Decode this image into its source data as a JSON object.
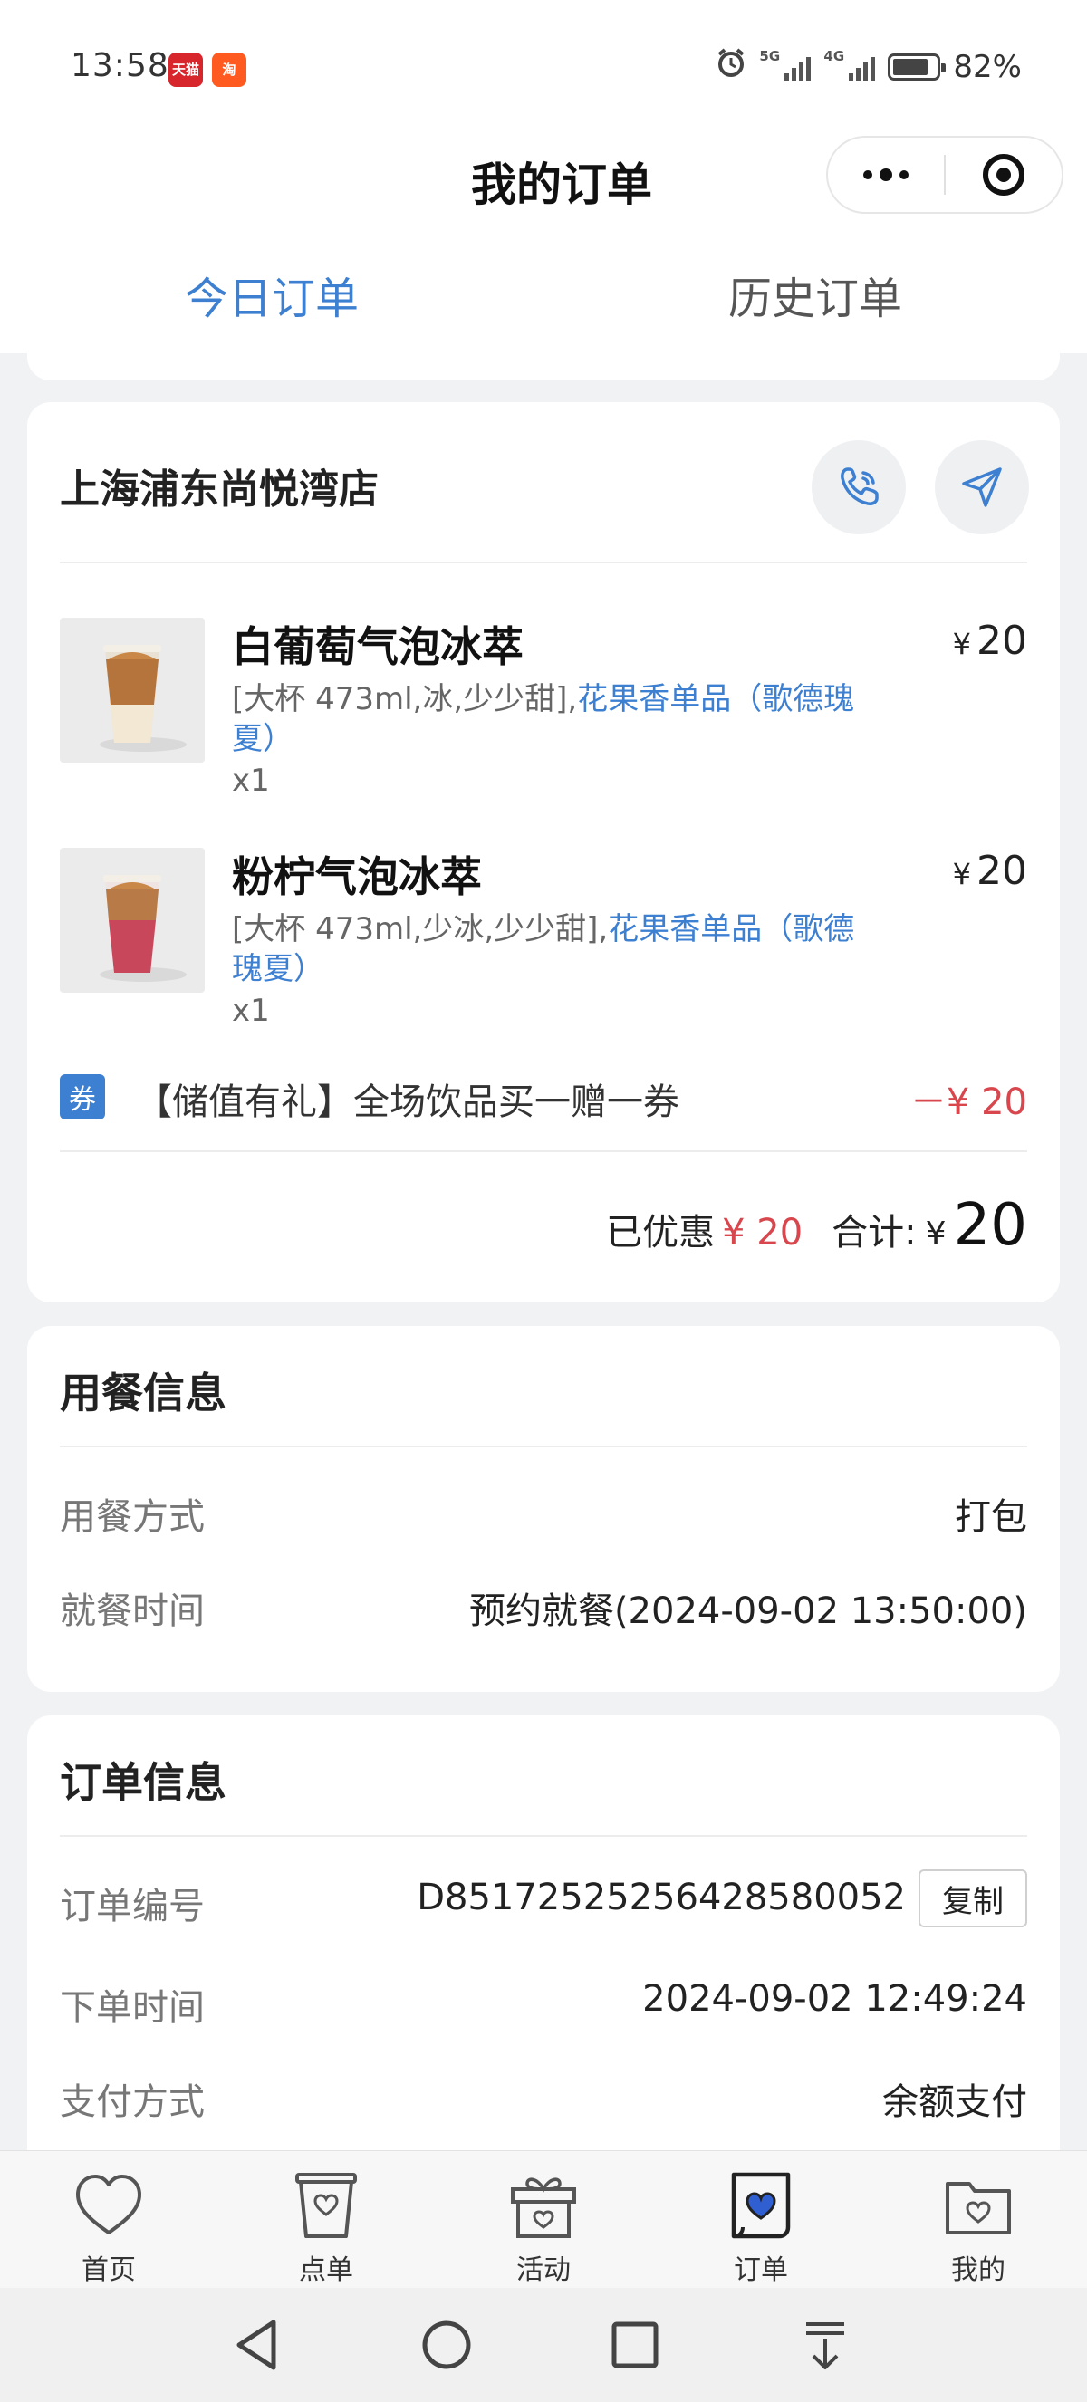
{
  "status_bar": {
    "time": "13:58",
    "app_badges": [
      "天猫",
      "淘"
    ],
    "signal_1": "5G",
    "signal_2": "4G",
    "battery_percent": 82,
    "battery_text": "82%"
  },
  "header": {
    "title": "我的订单"
  },
  "tabs": [
    {
      "label": "今日订单",
      "active": true
    },
    {
      "label": "历史订单",
      "active": false
    }
  ],
  "store": {
    "name": "上海浦东尚悦湾店",
    "icons": [
      "phone-icon",
      "navigate-icon"
    ]
  },
  "items": [
    {
      "name": "白葡萄气泡冰萃",
      "spec_plain": "[大杯 473ml,冰,少少甜],",
      "spec_highlight": "花果香单品（歌德瑰夏）",
      "qty": "x1",
      "currency": "¥",
      "price": "20"
    },
    {
      "name": "粉柠气泡冰萃",
      "spec_plain": "[大杯 473ml,少冰,少少甜],",
      "spec_highlight": "花果香单品（歌德瑰夏）",
      "qty": "x1",
      "currency": "¥",
      "price": "20"
    }
  ],
  "coupon": {
    "tag": "券",
    "text": "【储值有礼】全场饮品买一赠一券",
    "amount": "－¥ 20"
  },
  "totals": {
    "discount_label": "已优惠",
    "discount_value": "¥ 20",
    "sum_label": "合计:",
    "sum_currency": "¥",
    "sum_value": "20"
  },
  "dining": {
    "title": "用餐信息",
    "rows": [
      {
        "label": "用餐方式",
        "value": "打包"
      },
      {
        "label": "就餐时间",
        "value": "预约就餐(2024-09-02 13:50:00)"
      }
    ]
  },
  "order_info": {
    "title": "订单信息",
    "order_no_label": "订单编号",
    "order_no": "D85172525256428580052",
    "copy_label": "复制",
    "rows": [
      {
        "label": "下单时间",
        "value": "2024-09-02 12:49:24"
      },
      {
        "label": "支付方式",
        "value": "余额支付"
      }
    ]
  },
  "bottom_nav": [
    {
      "label": "首页",
      "icon": "heart-icon",
      "active": false
    },
    {
      "label": "点单",
      "icon": "cup-icon",
      "active": false
    },
    {
      "label": "活动",
      "icon": "gift-icon",
      "active": false
    },
    {
      "label": "订单",
      "icon": "order-icon",
      "active": true
    },
    {
      "label": "我的",
      "icon": "folder-icon",
      "active": false
    }
  ],
  "colors": {
    "accent": "#3d7fd1",
    "discount": "#d8474d",
    "background": "#f1f2f4"
  }
}
